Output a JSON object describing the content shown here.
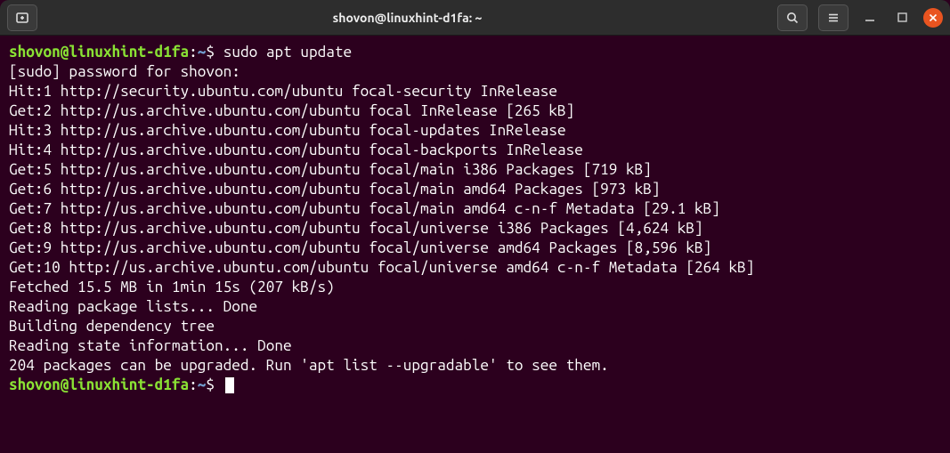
{
  "titlebar": {
    "title": "shovon@linuxhint-d1fa: ~"
  },
  "prompt": {
    "user_host": "shovon@linuxhint-d1fa",
    "colon": ":",
    "path": "~",
    "symbol": "$"
  },
  "command1": "sudo apt update",
  "lines": [
    "[sudo] password for shovon:",
    "Hit:1 http://security.ubuntu.com/ubuntu focal-security InRelease",
    "Get:2 http://us.archive.ubuntu.com/ubuntu focal InRelease [265 kB]",
    "Hit:3 http://us.archive.ubuntu.com/ubuntu focal-updates InRelease",
    "Hit:4 http://us.archive.ubuntu.com/ubuntu focal-backports InRelease",
    "Get:5 http://us.archive.ubuntu.com/ubuntu focal/main i386 Packages [719 kB]",
    "Get:6 http://us.archive.ubuntu.com/ubuntu focal/main amd64 Packages [973 kB]",
    "Get:7 http://us.archive.ubuntu.com/ubuntu focal/main amd64 c-n-f Metadata [29.1 kB]",
    "Get:8 http://us.archive.ubuntu.com/ubuntu focal/universe i386 Packages [4,624 kB]",
    "Get:9 http://us.archive.ubuntu.com/ubuntu focal/universe amd64 Packages [8,596 kB]",
    "Get:10 http://us.archive.ubuntu.com/ubuntu focal/universe amd64 c-n-f Metadata [264 kB]",
    "Fetched 15.5 MB in 1min 15s (207 kB/s)",
    "Reading package lists... Done",
    "Building dependency tree",
    "Reading state information... Done",
    "204 packages can be upgraded. Run 'apt list --upgradable' to see them."
  ]
}
